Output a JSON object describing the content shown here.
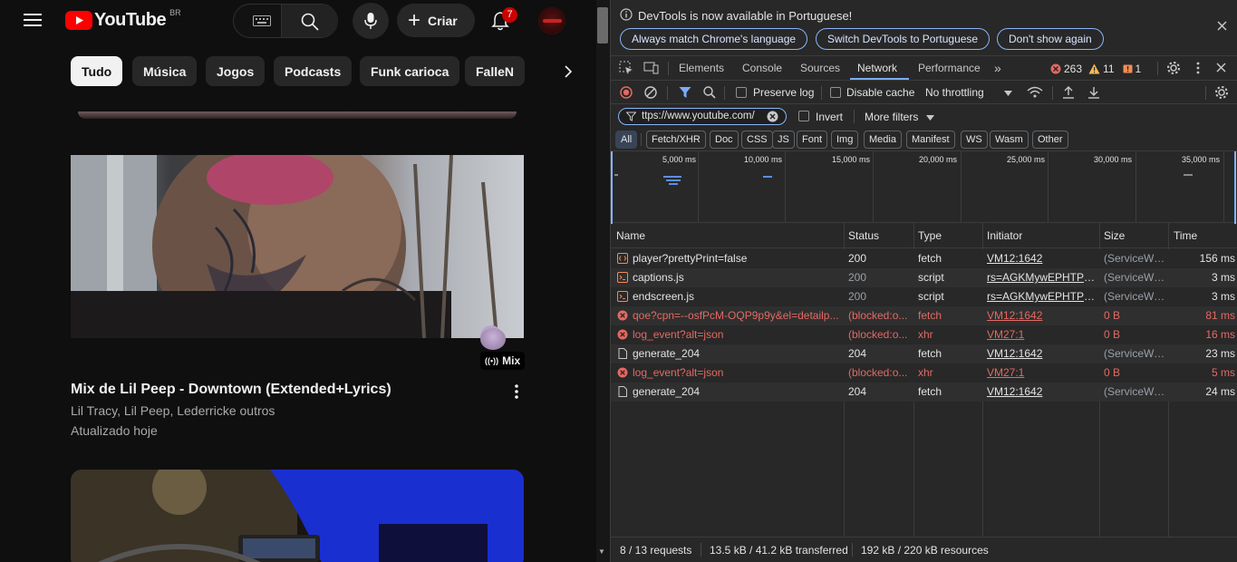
{
  "youtube": {
    "logo_text": "YouTube",
    "region": "BR",
    "create_label": "Criar",
    "notifications_count": "7",
    "chips": [
      "Tudo",
      "Música",
      "Jogos",
      "Podcasts",
      "Funk carioca",
      "FalleN"
    ],
    "video1": {
      "title": "Mix de Lil Peep - Downtown (Extended+Lyrics)",
      "channel": "Lil Tracy, Lil Peep, Lederricke outros",
      "updated": "Atualizado hoje",
      "badge": "Mix"
    }
  },
  "devtools": {
    "infobar": {
      "message": "DevTools is now available in Portuguese!",
      "btn_match": "Always match Chrome's language",
      "btn_switch": "Switch DevTools to Portuguese",
      "btn_dismiss": "Don't show again"
    },
    "tabs": [
      "Elements",
      "Console",
      "Sources",
      "Network",
      "Performance"
    ],
    "errors": "263",
    "warnings": "11",
    "issues": "1",
    "toolbar": {
      "preserve_log": "Preserve log",
      "disable_cache": "Disable cache",
      "throttling": "No throttling"
    },
    "filter": {
      "value": "ttps://www.youtube.com/",
      "invert": "Invert",
      "more_filters": "More filters"
    },
    "type_filters": [
      "All",
      "Fetch/XHR",
      "Doc",
      "CSS",
      "JS",
      "Font",
      "Img",
      "Media",
      "Manifest",
      "WS",
      "Wasm",
      "Other"
    ],
    "timeline_ticks": [
      "5,000 ms",
      "10,000 ms",
      "15,000 ms",
      "20,000 ms",
      "25,000 ms",
      "30,000 ms",
      "35,000 ms"
    ],
    "columns": [
      "Name",
      "Status",
      "Type",
      "Initiator",
      "Size",
      "Time"
    ],
    "requests": [
      {
        "icon": "fetch-icon",
        "name": "player?prettyPrint=false",
        "status": "200",
        "type": "fetch",
        "initiator": "VM12:1642",
        "size": "(ServiceWo...",
        "time": "156 ms",
        "error": false,
        "dim": false
      },
      {
        "icon": "script-icon",
        "name": "captions.js",
        "status": "200",
        "type": "script",
        "initiator": "rs=AGKMywEPHTPbTmy",
        "size": "(ServiceWo...",
        "time": "3 ms",
        "error": false,
        "dim": true
      },
      {
        "icon": "script-icon",
        "name": "endscreen.js",
        "status": "200",
        "type": "script",
        "initiator": "rs=AGKMywEPHTPbTmy",
        "size": "(ServiceWo...",
        "time": "3 ms",
        "error": false,
        "dim": true
      },
      {
        "icon": "error-icon",
        "name": "qoe?cpn=--osfPcM-OQP9p9y&el=detailp...",
        "status": "(blocked:o...",
        "type": "fetch",
        "initiator": "VM12:1642",
        "size": "0 B",
        "time": "81 ms",
        "error": true,
        "dim": false
      },
      {
        "icon": "error-icon",
        "name": "log_event?alt=json",
        "status": "(blocked:o...",
        "type": "xhr",
        "initiator": "VM27:1",
        "size": "0 B",
        "time": "16 ms",
        "error": true,
        "dim": false
      },
      {
        "icon": "document-icon",
        "name": "generate_204",
        "status": "204",
        "type": "fetch",
        "initiator": "VM12:1642",
        "size": "(ServiceWo...",
        "time": "23 ms",
        "error": false,
        "dim": false
      },
      {
        "icon": "error-icon",
        "name": "log_event?alt=json",
        "status": "(blocked:o...",
        "type": "xhr",
        "initiator": "VM27:1",
        "size": "0 B",
        "time": "5 ms",
        "error": true,
        "dim": false
      },
      {
        "icon": "document-icon",
        "name": "generate_204",
        "status": "204",
        "type": "fetch",
        "initiator": "VM12:1642",
        "size": "(ServiceWo...",
        "time": "24 ms",
        "error": false,
        "dim": false
      }
    ],
    "status_bar": {
      "requests": "8 / 13 requests",
      "transferred": "13.5 kB / 41.2 kB transferred",
      "resources": "192 kB / 220 kB resources"
    }
  }
}
